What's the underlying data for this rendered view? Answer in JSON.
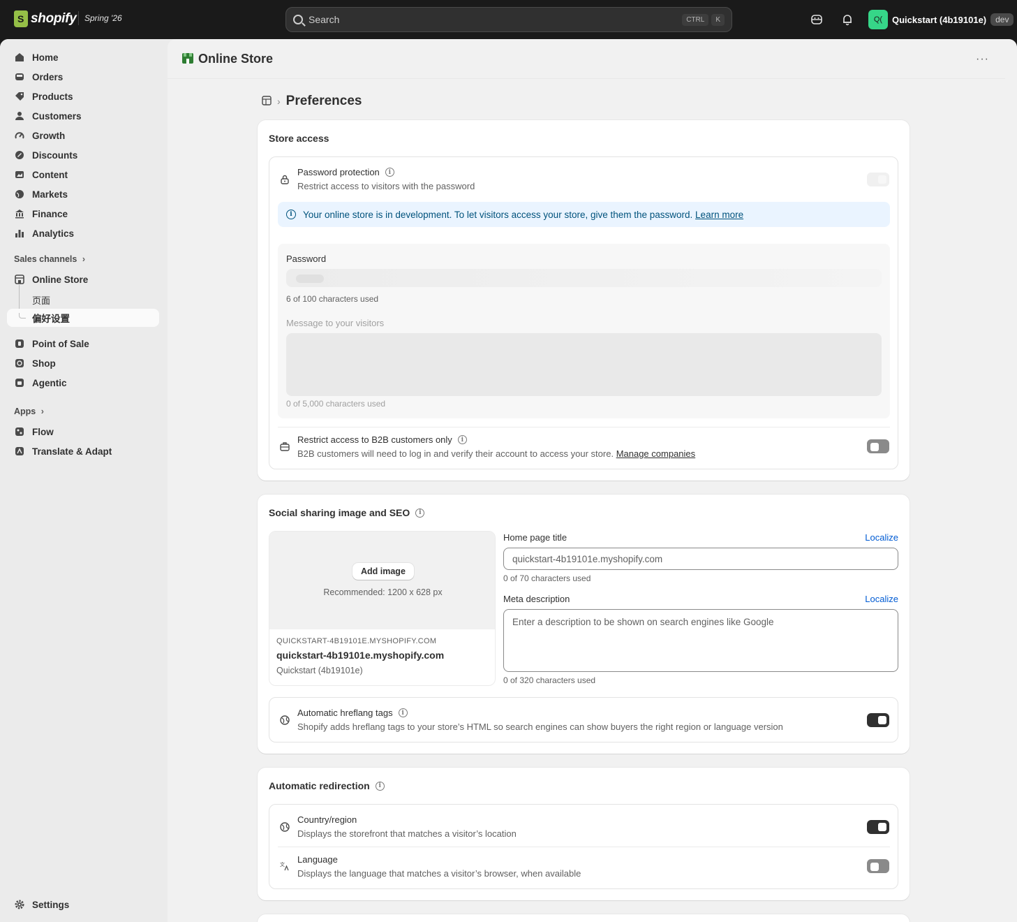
{
  "topbar": {
    "brand": "shopify",
    "season": "Spring '26",
    "search_placeholder": "Search",
    "shortcut_ctrl": "CTRL",
    "shortcut_key": "K",
    "store_initials": "Q(",
    "store_name": "Quickstart (4b19101e)",
    "env_badge": "dev"
  },
  "sidebar": {
    "items": [
      {
        "label": "Home",
        "icon": "home-icon"
      },
      {
        "label": "Orders",
        "icon": "inbox-icon"
      },
      {
        "label": "Products",
        "icon": "tag-icon"
      },
      {
        "label": "Customers",
        "icon": "person-icon"
      },
      {
        "label": "Growth",
        "icon": "gauge-icon"
      },
      {
        "label": "Discounts",
        "icon": "discount-icon"
      },
      {
        "label": "Content",
        "icon": "image-icon"
      },
      {
        "label": "Markets",
        "icon": "globe-icon"
      },
      {
        "label": "Finance",
        "icon": "bank-icon"
      },
      {
        "label": "Analytics",
        "icon": "bar-chart-icon"
      }
    ],
    "sales_channels_label": "Sales channels",
    "online_store_label": "Online Store",
    "sub_pages_label": "页面",
    "sub_preferences_label": "偏好设置",
    "channels": [
      {
        "label": "Point of Sale",
        "icon": "pos-icon"
      },
      {
        "label": "Shop",
        "icon": "shop-icon"
      },
      {
        "label": "Agentic",
        "icon": "agentic-icon"
      }
    ],
    "apps_label": "Apps",
    "apps": [
      {
        "label": "Flow",
        "icon": "flow-icon"
      },
      {
        "label": "Translate & Adapt",
        "icon": "translate-icon"
      }
    ],
    "settings_label": "Settings"
  },
  "header": {
    "title": "Online Store",
    "more_label": "···"
  },
  "breadcrumb": {
    "title": "Preferences"
  },
  "store_access": {
    "title": "Store access",
    "password_protection_title": "Password protection",
    "password_protection_desc": "Restrict access to visitors with the password",
    "banner_text": "Your online store is in development. To let visitors access your store, give them the password.",
    "banner_link": "Learn more",
    "password_label": "Password",
    "password_help": "6 of 100 characters used",
    "message_label": "Message to your visitors",
    "message_help": "0 of 5,000 characters used",
    "b2b_title": "Restrict access to B2B customers only",
    "b2b_desc": "B2B customers will need to log in and verify their account to access your store.",
    "b2b_link": "Manage companies"
  },
  "seo": {
    "title": "Social sharing image and SEO",
    "add_image": "Add image",
    "recommended": "Recommended: 1200 x 628 px",
    "preview_url": "QUICKSTART-4B19101E.MYSHOPIFY.COM",
    "preview_title": "quickstart-4b19101e.myshopify.com",
    "preview_name": "Quickstart (4b19101e)",
    "home_title_label": "Home page title",
    "localize": "Localize",
    "home_title_value": "quickstart-4b19101e.myshopify.com",
    "home_title_help": "0 of 70 characters used",
    "meta_label": "Meta description",
    "meta_placeholder": "Enter a description to be shown on search engines like Google",
    "meta_help": "0 of 320 characters used",
    "hreflang_title": "Automatic hreflang tags",
    "hreflang_desc": "Shopify adds hreflang tags to your store’s HTML so search engines can show buyers the right region or language version"
  },
  "redirection": {
    "title": "Automatic redirection",
    "country_title": "Country/region",
    "country_desc": "Displays the storefront that matches a visitor’s location",
    "language_title": "Language",
    "language_desc": "Displays the language that matches a visitor’s browser, when available"
  },
  "toggles": {
    "password_protection": "disabled-on",
    "b2b_only": "off",
    "hreflang": "on",
    "country_redirect": "on",
    "language_redirect": "off"
  },
  "colors": {
    "topbar": "#1a1a1a",
    "accent_link": "#005bd3",
    "banner_bg": "#eaf4ff",
    "avatar": "#36d688"
  }
}
